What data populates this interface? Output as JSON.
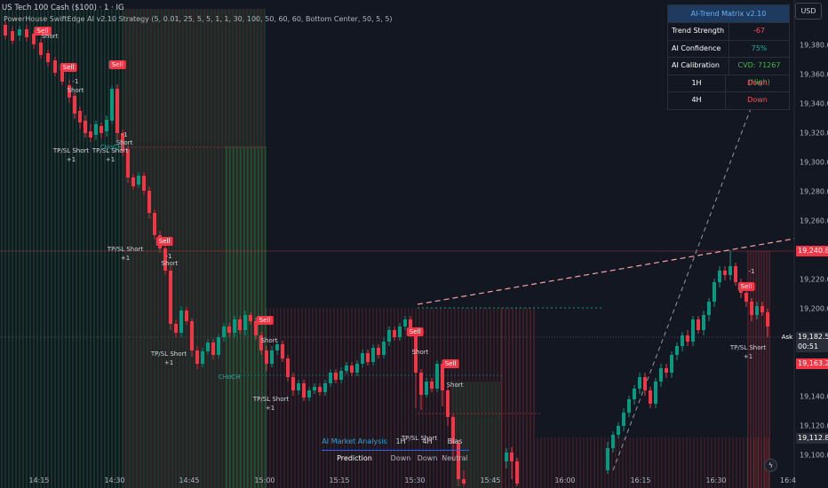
{
  "header": {
    "title": "US Tech 100 Cash ($100) · 1 · IG",
    "indicator": "PowerHouse SwiftEdge AI v2.10 Strategy (5, 0.01, 25, 5, 5, 1, 1, 30, 100, 50, 60, 60, Bottom Center, 50, 5, 5)"
  },
  "currency": "USD",
  "y_axis": {
    "ticks": [
      "19,380.0",
      "19,360.0",
      "19,340.0",
      "19,320.0",
      "19,300.0",
      "19,280.0",
      "19,260.0",
      "19,220.0",
      "19,200.0",
      "19,140.0",
      "19,120.0",
      "19,100.0"
    ],
    "price_labels": [
      {
        "text": "19,240.8",
        "color": "#f23645"
      },
      {
        "text": "19,182.5",
        "color": "#2a2e39"
      },
      {
        "text": "00:51",
        "color": "#2a2e39"
      },
      {
        "text": "19,163.2",
        "color": "#f23645"
      },
      {
        "text": "19,112.8",
        "color": "#2a2e39"
      }
    ]
  },
  "x_axis": {
    "ticks": [
      "14:15",
      "14:30",
      "14:45",
      "15:00",
      "15:15",
      "15:30",
      "15:45",
      "16:00",
      "16:15",
      "16:30",
      "16:4"
    ]
  },
  "trend_matrix": {
    "title": "AI-Trend Matrix v2.10",
    "rows": [
      {
        "label": "Trend Strength",
        "value": "-67",
        "color": "#f7525f"
      },
      {
        "label": "AI Confidence",
        "value": "75%",
        "color": "#26a69a"
      },
      {
        "label": "AI Calibration",
        "value": "CVD: 71267 (High)",
        "color": "#4caf50"
      },
      {
        "label": "1H",
        "value": "Down",
        "color": "#f7525f"
      },
      {
        "label": "4H",
        "value": "Down",
        "color": "#f7525f"
      }
    ]
  },
  "analysis": {
    "title": "AI Market Analysis",
    "cols": [
      "1H",
      "4H",
      "Bias"
    ],
    "row_label": "Prediction",
    "row_values": [
      "Down",
      "Down",
      "Neutral"
    ]
  },
  "signals": [
    {
      "kind": "sell",
      "text": "Sell"
    },
    {
      "kind": "short",
      "text": "Short"
    },
    {
      "kind": "tp",
      "text": "TP/SL Short"
    },
    {
      "kind": "count",
      "text": "+1"
    },
    {
      "kind": "minus",
      "text": "-1"
    },
    {
      "kind": "choch",
      "text": "CHoCH"
    },
    {
      "kind": "ask",
      "text": "Ask"
    }
  ],
  "colors": {
    "bull": "#089981",
    "bear": "#f23645",
    "bg": "#131722"
  }
}
